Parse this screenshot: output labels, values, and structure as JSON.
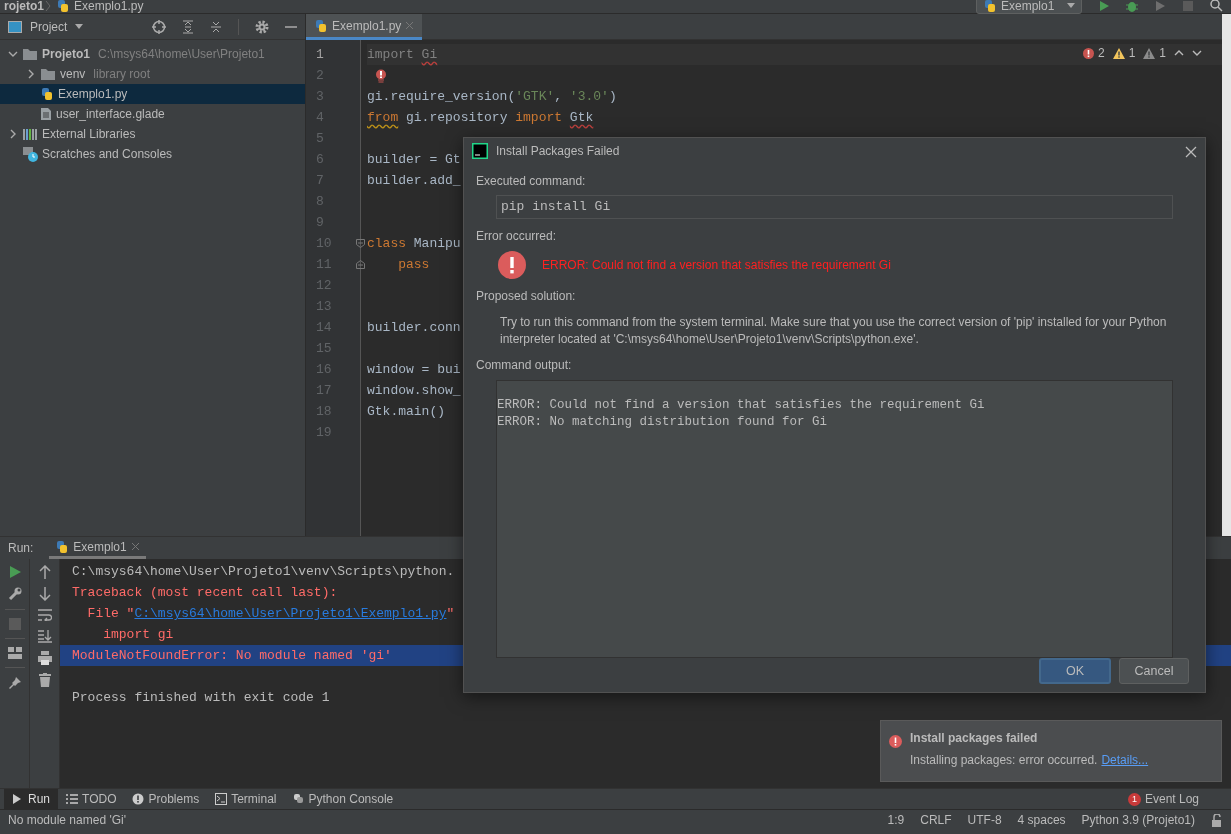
{
  "breadcrumb": [
    {
      "label": "rojeto1",
      "kind": "folder"
    },
    {
      "label": "Exemplo1.py",
      "kind": "python"
    }
  ],
  "run_config": {
    "label": "Exemplo1"
  },
  "project_panel": {
    "title": "Project",
    "tree": [
      {
        "label": "Projeto1",
        "hint": "C:\\msys64\\home\\User\\Projeto1",
        "kind": "project",
        "expanded": true,
        "selected": false,
        "children": [
          {
            "label": "venv",
            "hint": "library root",
            "kind": "folder",
            "expanded": false,
            "selected": false
          },
          {
            "label": "Exemplo1.py",
            "kind": "python",
            "selected": true
          },
          {
            "label": "user_interface.glade",
            "kind": "file",
            "selected": false
          }
        ]
      },
      {
        "label": "External Libraries",
        "kind": "libraries",
        "expanded": false,
        "selected": false
      },
      {
        "label": "Scratches and Consoles",
        "kind": "scratches",
        "selected": false
      }
    ]
  },
  "editor": {
    "tabs": [
      {
        "label": "Exemplo1.py",
        "selected": true
      }
    ],
    "inspections": {
      "errors": "2",
      "warnings": "1",
      "weak_warnings": "1"
    },
    "lines": [
      {
        "number": "1",
        "current": true,
        "tokens": [
          {
            "t": "import ",
            "kind": "unused"
          },
          {
            "t": "Gi",
            "kind": "unused-error"
          }
        ]
      },
      {
        "number": "2",
        "current": false,
        "kind": "bulb"
      },
      {
        "number": "3",
        "current": false,
        "tokens": [
          {
            "t": "gi.require_version("
          },
          {
            "t": "'GTK'",
            "kind": "string"
          },
          {
            "t": ", "
          },
          {
            "t": "'3.0'",
            "kind": "string"
          },
          {
            "t": ")"
          }
        ]
      },
      {
        "number": "4",
        "current": false,
        "tokens": [
          {
            "t": "from",
            "kind": "keyword-warning"
          },
          {
            "t": " gi.repository "
          },
          {
            "t": "import ",
            "kind": "keyword"
          },
          {
            "t": "Gtk",
            "kind": "error"
          }
        ]
      },
      {
        "number": "5",
        "current": false
      },
      {
        "number": "6",
        "current": false,
        "tokens": [
          {
            "t": "builder = Gt"
          }
        ]
      },
      {
        "number": "7",
        "current": false,
        "tokens": [
          {
            "t": "builder.add_"
          }
        ]
      },
      {
        "number": "8",
        "current": false
      },
      {
        "number": "9",
        "current": false
      },
      {
        "number": "10",
        "current": false,
        "kind": "fold-start",
        "tokens": [
          {
            "t": "class",
            "kind": "keyword"
          },
          {
            "t": " Manipu"
          }
        ]
      },
      {
        "number": "11",
        "current": false,
        "kind": "fold-end",
        "tokens": [
          {
            "t": "    pass",
            "kind": "keyword"
          }
        ]
      },
      {
        "number": "12",
        "current": false
      },
      {
        "number": "13",
        "current": false
      },
      {
        "number": "14",
        "current": false,
        "tokens": [
          {
            "t": "builder.conn"
          }
        ]
      },
      {
        "number": "15",
        "current": false
      },
      {
        "number": "16",
        "current": false,
        "tokens": [
          {
            "t": "window = bui"
          }
        ]
      },
      {
        "number": "17",
        "current": false,
        "tokens": [
          {
            "t": "window.show_"
          }
        ]
      },
      {
        "number": "18",
        "current": false,
        "tokens": [
          {
            "t": "Gtk.main()"
          }
        ]
      },
      {
        "number": "19",
        "current": false
      }
    ]
  },
  "run_panel": {
    "label": "Run:",
    "tabs": [
      {
        "label": "Exemplo1",
        "selected": true
      }
    ],
    "console": [
      {
        "selected": false,
        "segments": [
          {
            "t": "C:\\msys64\\home\\User\\Projeto1\\venv\\Scripts\\python."
          }
        ]
      },
      {
        "selected": false,
        "segments": [
          {
            "t": "Traceback (most recent call last):",
            "kind": "error"
          }
        ]
      },
      {
        "selected": false,
        "segments": [
          {
            "t": "  File \"",
            "kind": "error"
          },
          {
            "t": "C:\\msys64\\home\\User\\Projeto1\\Exemplo1.py",
            "kind": "link"
          },
          {
            "t": "\"",
            "kind": "error"
          }
        ]
      },
      {
        "selected": false,
        "segments": [
          {
            "t": "    import gi",
            "kind": "error"
          }
        ]
      },
      {
        "selected": true,
        "segments": [
          {
            "t": "ModuleNotFoundError: No module named 'gi'",
            "kind": "error"
          }
        ]
      },
      {
        "selected": false,
        "space_before": true,
        "segments": [
          {
            "t": "Process finished with exit code 1"
          }
        ]
      }
    ]
  },
  "tool_windows": [
    {
      "label": "Run",
      "kind": "run",
      "selected": true
    },
    {
      "label": "TODO",
      "kind": "todo",
      "selected": false
    },
    {
      "label": "Problems",
      "kind": "problems",
      "selected": false
    },
    {
      "label": "Terminal",
      "kind": "terminal",
      "selected": false
    },
    {
      "label": "Python Console",
      "kind": "console",
      "selected": false
    }
  ],
  "event_log": {
    "label": "Event Log",
    "count": "1"
  },
  "status_bar": {
    "message": "No module named 'Gi'",
    "items": [
      "1:9",
      "CRLF",
      "UTF-8",
      "4 spaces",
      "Python 3.9 (Projeto1)"
    ]
  },
  "dialog": {
    "title": "Install Packages Failed",
    "command_label": "Executed command:",
    "command": "pip install Gi",
    "error_label": "Error occurred:",
    "error": "ERROR: Could not find a version that satisfies the requirement Gi",
    "solution_label": "Proposed solution:",
    "solution": "Try to run this command from the system terminal. Make sure that you use the correct version of 'pip' installed for your Python interpreter located at 'C:\\msys64\\home\\User\\Projeto1\\venv\\Scripts\\python.exe'.",
    "output_label": "Command output:",
    "output": [
      "ERROR: Could not find a version that satisfies the requirement Gi",
      "ERROR: No matching distribution found for Gi"
    ],
    "buttons": [
      {
        "label": "OK",
        "default": true
      },
      {
        "label": "Cancel",
        "default": false
      }
    ]
  },
  "notification": {
    "title": "Install packages failed",
    "text": "Installing packages: error occurred.",
    "link": "Details..."
  }
}
